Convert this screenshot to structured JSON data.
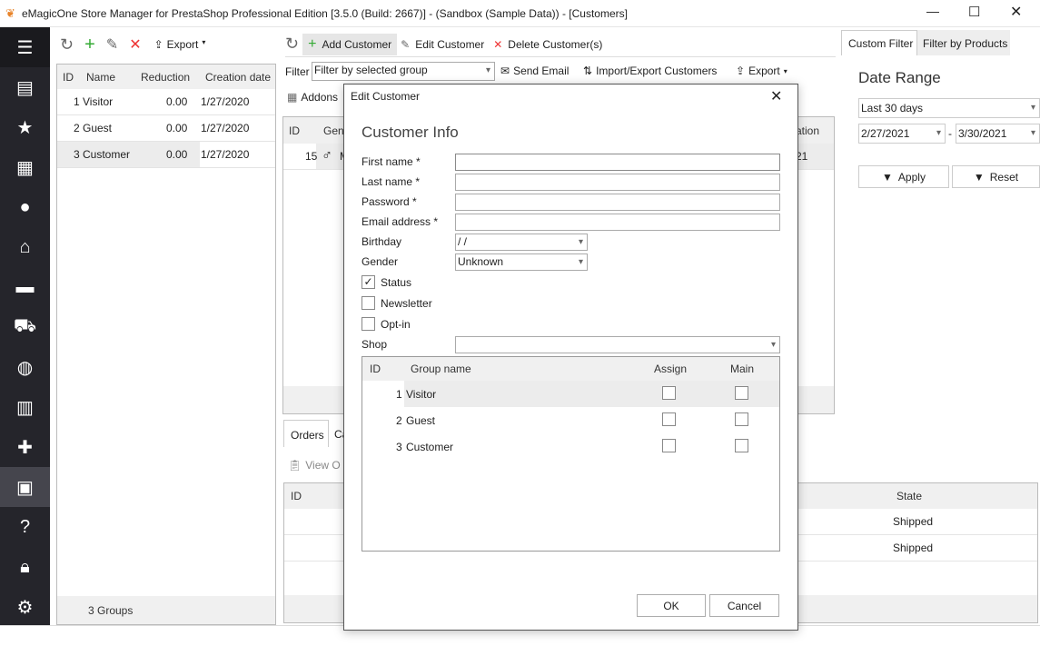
{
  "window": {
    "title": "eMagicOne Store Manager for PrestaShop Professional Edition [3.5.0 (Build: 2667)] - (Sandbox (Sample Data)) - [Customers]"
  },
  "sidebar": {
    "items": [
      "menu",
      "store",
      "favorites",
      "products",
      "customers",
      "orders",
      "messages",
      "shipping",
      "web",
      "reports",
      "addons",
      "store-manager",
      "help",
      "security",
      "settings"
    ]
  },
  "groups_panel": {
    "toolbar": {
      "export": "Export"
    },
    "columns": [
      "ID",
      "Name",
      "Reduction",
      "Creation date"
    ],
    "rows": [
      {
        "id": "1",
        "name": "Visitor",
        "reduction": "0.00",
        "date": "1/27/2020"
      },
      {
        "id": "2",
        "name": "Guest",
        "reduction": "0.00",
        "date": "1/27/2020"
      },
      {
        "id": "3",
        "name": "Customer",
        "reduction": "0.00",
        "date": "1/27/2020"
      }
    ],
    "footer": "3 Groups"
  },
  "customers_panel": {
    "toolbar": {
      "add": "Add Customer",
      "edit": "Edit Customer",
      "delete": "Delete Customer(s)"
    },
    "filter_label": "Filter",
    "filter_value": "Filter by selected group",
    "send_email": "Send Email",
    "import_export": "Import/Export Customers",
    "export": "Export",
    "addons": "Addons",
    "columns": [
      "ID",
      "Gend",
      "ation"
    ],
    "row": {
      "id": "15",
      "gender": "M",
      "date": "21"
    }
  },
  "bottom": {
    "tabs": [
      "Orders",
      "Ca"
    ],
    "view_orders": "View O",
    "columns": {
      "id": "ID",
      "state": "State"
    },
    "states": [
      "Shipped",
      "Shipped"
    ]
  },
  "right_panel": {
    "tabs": [
      "Custom Filter",
      "Filter by Products"
    ],
    "heading": "Date Range",
    "range": "Last 30 days",
    "from": "2/27/2021",
    "to": "3/30/2021",
    "dash": "-",
    "apply": "Apply",
    "reset": "Reset"
  },
  "dialog": {
    "title": "Edit Customer",
    "heading": "Customer Info",
    "fields": {
      "first_name": "First name *",
      "last_name": "Last name *",
      "password": "Password *",
      "email": "Email address *",
      "birthday": "Birthday",
      "birthday_value": " /  /",
      "gender": "Gender",
      "gender_value": "Unknown",
      "shop": "Shop"
    },
    "checkboxes": [
      {
        "label": "Status",
        "checked": true
      },
      {
        "label": "Newsletter",
        "checked": false
      },
      {
        "label": "Opt-in",
        "checked": false
      }
    ],
    "group_columns": [
      "ID",
      "Group name",
      "Assign",
      "Main"
    ],
    "groups": [
      {
        "id": "1",
        "name": "Visitor",
        "assign": false,
        "main": false
      },
      {
        "id": "2",
        "name": "Guest",
        "assign": false,
        "main": false
      },
      {
        "id": "3",
        "name": "Customer",
        "assign": false,
        "main": false
      }
    ],
    "ok": "OK",
    "cancel": "Cancel"
  }
}
